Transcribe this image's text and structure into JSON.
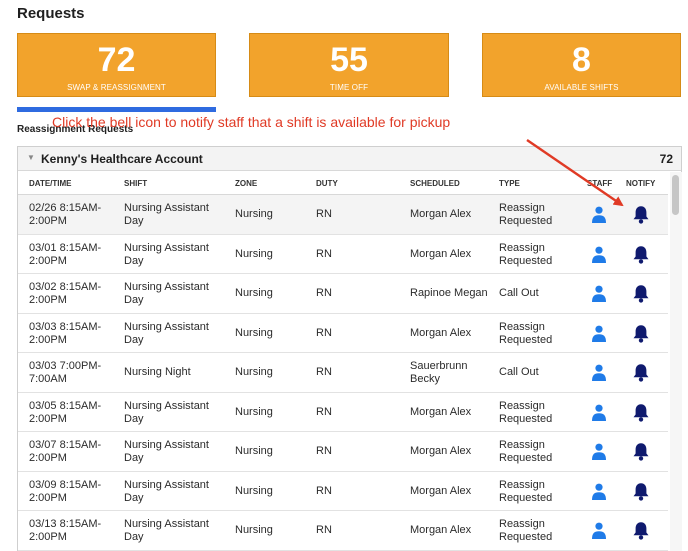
{
  "page_title": "Requests",
  "stats": [
    {
      "value": "72",
      "label": "SWAP & REASSIGNMENT"
    },
    {
      "value": "55",
      "label": "TIME OFF"
    },
    {
      "value": "8",
      "label": "AVAILABLE SHIFTS"
    }
  ],
  "annotation": "Click the bell icon to notify staff that a shift is available for pickup",
  "section_label": "Reassignment Requests",
  "account": {
    "name": "Kenny's Healthcare Account",
    "count": "72"
  },
  "columns": {
    "datetime": "DATE/TIME",
    "shift": "SHIFT",
    "zone": "ZONE",
    "duty": "DUTY",
    "scheduled": "SCHEDULED",
    "type": "TYPE",
    "staff": "STAFF",
    "notify": "NOTIFY"
  },
  "rows": [
    {
      "date": "02/26 8:15AM-",
      "time": "2:00PM",
      "shift1": "Nursing Assistant",
      "shift2": "Day",
      "zone": "Nursing",
      "duty": "RN",
      "sched1": "Morgan Alex",
      "sched2": "",
      "type1": "Reassign",
      "type2": "Requested"
    },
    {
      "date": "03/01 8:15AM-",
      "time": "2:00PM",
      "shift1": "Nursing Assistant",
      "shift2": "Day",
      "zone": "Nursing",
      "duty": "RN",
      "sched1": "Morgan Alex",
      "sched2": "",
      "type1": "Reassign",
      "type2": "Requested"
    },
    {
      "date": "03/02 8:15AM-",
      "time": "2:00PM",
      "shift1": "Nursing Assistant",
      "shift2": "Day",
      "zone": "Nursing",
      "duty": "RN",
      "sched1": "Rapinoe Megan",
      "sched2": "",
      "type1": "Call Out",
      "type2": ""
    },
    {
      "date": "03/03 8:15AM-",
      "time": "2:00PM",
      "shift1": "Nursing Assistant",
      "shift2": "Day",
      "zone": "Nursing",
      "duty": "RN",
      "sched1": "Morgan Alex",
      "sched2": "",
      "type1": "Reassign",
      "type2": "Requested"
    },
    {
      "date": "03/03 7:00PM-",
      "time": "7:00AM",
      "shift1": "Nursing Night",
      "shift2": "",
      "zone": "Nursing",
      "duty": "RN",
      "sched1": "Sauerbrunn",
      "sched2": "Becky",
      "type1": "Call Out",
      "type2": ""
    },
    {
      "date": "03/05 8:15AM-",
      "time": "2:00PM",
      "shift1": "Nursing Assistant",
      "shift2": "Day",
      "zone": "Nursing",
      "duty": "RN",
      "sched1": "Morgan Alex",
      "sched2": "",
      "type1": "Reassign",
      "type2": "Requested"
    },
    {
      "date": "03/07 8:15AM-",
      "time": "2:00PM",
      "shift1": "Nursing Assistant",
      "shift2": "Day",
      "zone": "Nursing",
      "duty": "RN",
      "sched1": "Morgan Alex",
      "sched2": "",
      "type1": "Reassign",
      "type2": "Requested"
    },
    {
      "date": "03/09 8:15AM-",
      "time": "2:00PM",
      "shift1": "Nursing Assistant",
      "shift2": "Day",
      "zone": "Nursing",
      "duty": "RN",
      "sched1": "Morgan Alex",
      "sched2": "",
      "type1": "Reassign",
      "type2": "Requested"
    },
    {
      "date": "03/13 8:15AM-",
      "time": "2:00PM",
      "shift1": "Nursing Assistant",
      "shift2": "Day",
      "zone": "Nursing",
      "duty": "RN",
      "sched1": "Morgan Alex",
      "sched2": "",
      "type1": "Reassign",
      "type2": "Requested"
    }
  ],
  "icons": {
    "staff": "person-icon",
    "notify": "bell-icon",
    "collapse": "caret-down-icon"
  },
  "colors": {
    "card": "#f2a32c",
    "active_tab": "#2f6be0",
    "annotation": "#e03a25",
    "staff_icon": "#1f7be8",
    "bell_icon": "#0f1a6e"
  }
}
